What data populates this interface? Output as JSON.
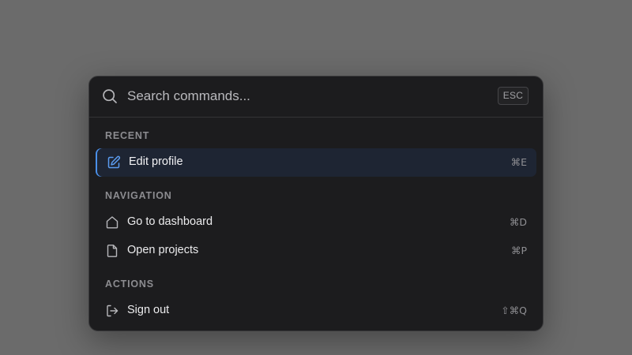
{
  "search": {
    "placeholder": "Search commands...",
    "escape_key": "ESC"
  },
  "sections": [
    {
      "label": "RECENT",
      "items": [
        {
          "label": "Edit profile",
          "shortcut": "⌘E",
          "icon": "pencil-square-icon",
          "active": true
        }
      ]
    },
    {
      "label": "NAVIGATION",
      "items": [
        {
          "label": "Go to dashboard",
          "shortcut": "⌘D",
          "icon": "home-icon"
        },
        {
          "label": "Open projects",
          "shortcut": "⌘P",
          "icon": "file-icon"
        }
      ]
    },
    {
      "label": "ACTIONS",
      "items": [
        {
          "label": "Sign out",
          "shortcut": "⇧⌘Q",
          "icon": "sign-out-icon"
        }
      ]
    }
  ],
  "colors": {
    "backdrop": "#6b6b6b",
    "panel": "#1c1c1e",
    "active_item_bg": "#1e2533",
    "accent": "#4a8fe8"
  }
}
